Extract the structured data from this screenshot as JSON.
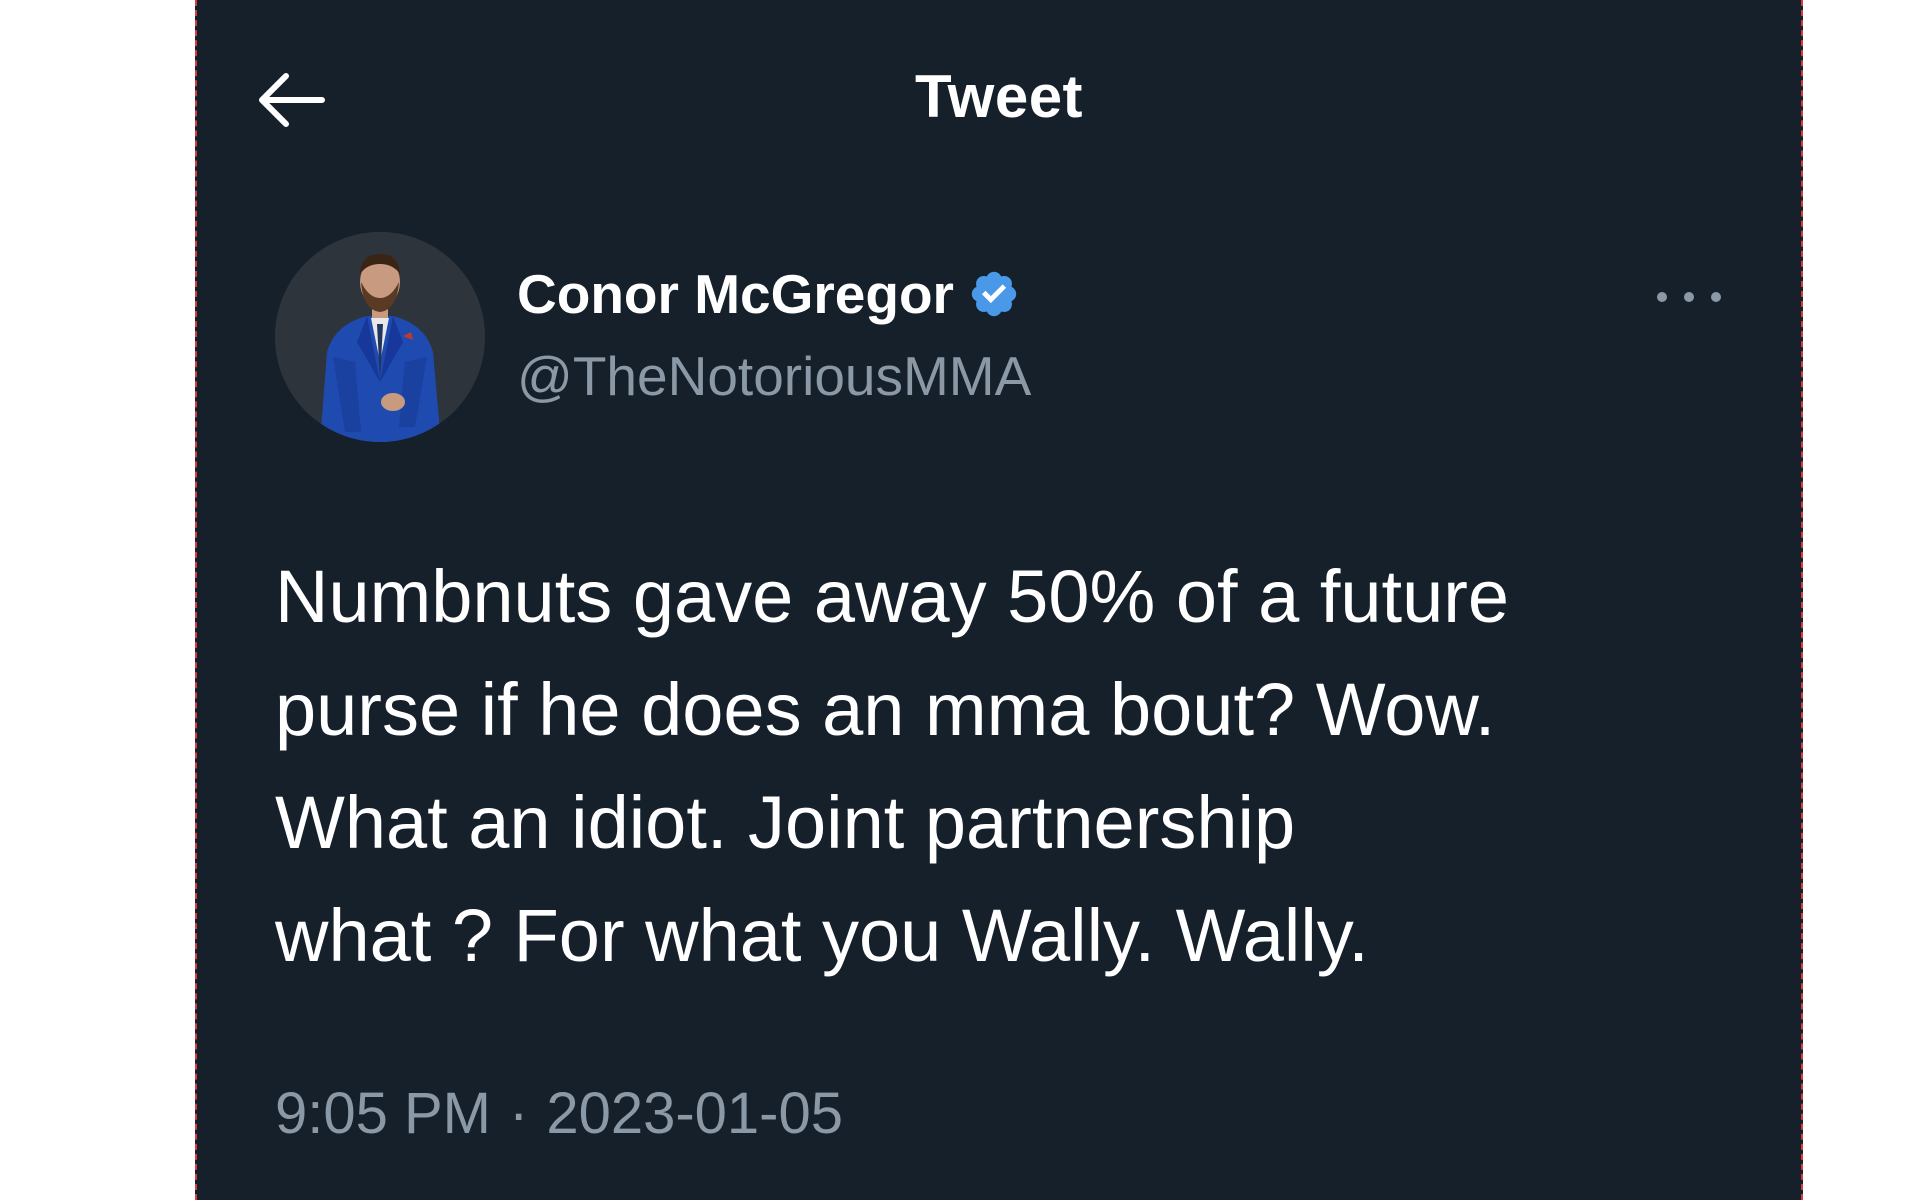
{
  "header": {
    "title": "Tweet",
    "back_icon": "arrow-left-icon"
  },
  "author": {
    "display_name": "Conor McGregor",
    "handle": "@TheNotoriousMMA",
    "verified": true,
    "verified_color": "#4a99e9",
    "more_icon": "ellipsis-icon"
  },
  "tweet": {
    "text": "Numbnuts gave away 50% of a future\npurse if he does an mma bout? Wow.\nWhat an idiot. Joint partnership\nwhat ? For what you Wally. Wally.",
    "time": "9:05 PM",
    "separator": "·",
    "date": "2023-01-05"
  },
  "colors": {
    "background": "#15202b",
    "primary_text": "#ffffff",
    "secondary_text": "#8b98a5",
    "frame_border": "#d93a3a"
  }
}
